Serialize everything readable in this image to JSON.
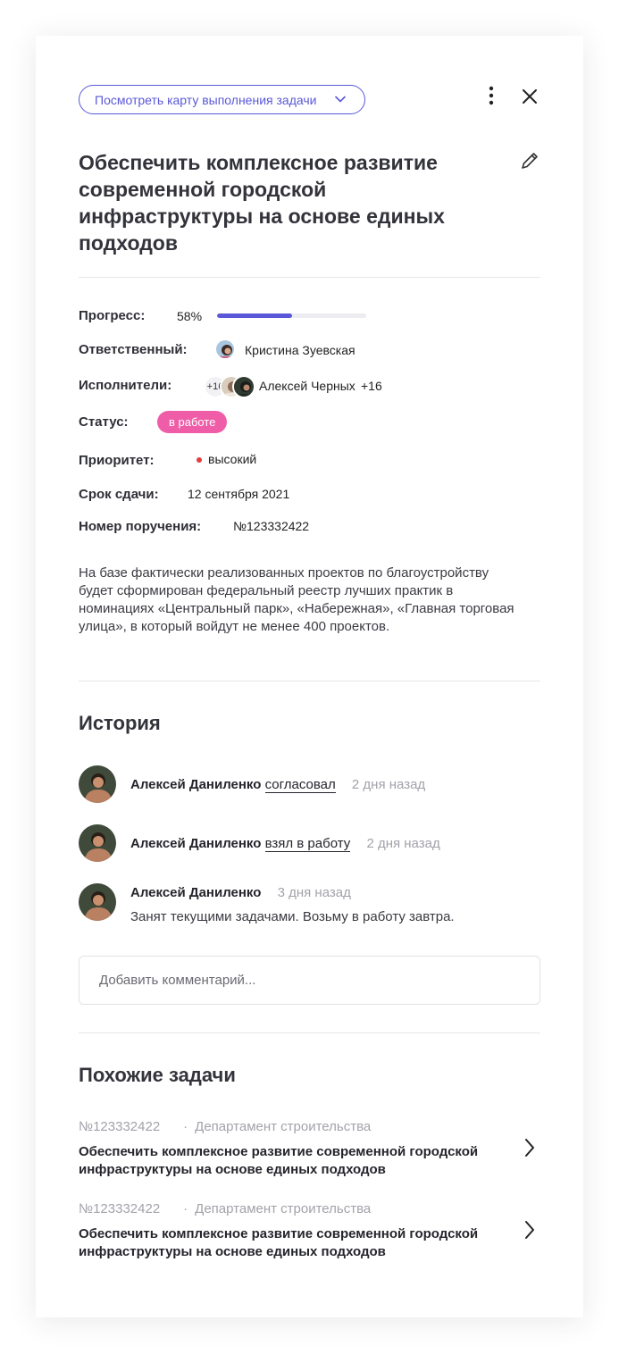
{
  "header": {
    "map_button_label": "Посмотреть карту выполнения задачи"
  },
  "task": {
    "title": "Обеспечить комплексное развитие современной городской инфраструктуры на основе единых подходов",
    "description": "На базе  фактически реализованных проектов по благоустройству будет сформирован федеральный реестр лучших практик в номинациях «Центральный парк», «Набережная», «Главная торговая улица», в который войдут не менее 400 проектов."
  },
  "properties": {
    "progress_label": "Прогресс:",
    "progress_value": "58%",
    "progress_fraction": 0.5,
    "responsible_label": "Ответственный:",
    "responsible_name": "Кристина Зуевская",
    "executors_label": "Исполнители:",
    "executors_count_badge": "+16",
    "executors_name": "Алексей Черных",
    "executors_more": "+16",
    "status_label": "Статус:",
    "status_value": "в работе",
    "priority_label": "Приоритет:",
    "priority_value": "высокий",
    "deadline_label": "Срок сдачи:",
    "deadline_value": "12 сентября 2021",
    "order_label": "Номер поручения:",
    "order_value": "№123332422"
  },
  "history": {
    "title": "История",
    "items": [
      {
        "name": "Алексей Даниленко",
        "action": "согласовал",
        "time": "2 дня назад"
      },
      {
        "name": "Алексей Даниленко",
        "action": "взял в работу",
        "time": "2 дня назад"
      },
      {
        "name": "Алексей Даниленко",
        "action": "",
        "time": "3 дня назад",
        "comment": "Занят текущими задачами. Возьму в работу завтра."
      }
    ],
    "comment_placeholder": "Добавить комментарий..."
  },
  "similar": {
    "title": "Похожие задачи",
    "items": [
      {
        "number": "№123332422",
        "dept": "Департамент строительства",
        "title": "Обеспечить комплексное развитие современной городской инфраструктуры на основе единых подходов"
      },
      {
        "number": "№123332422",
        "dept": "Департамент строительства",
        "title": "Обеспечить комплексное развитие современной городской инфраструктуры на основе единых подходов"
      }
    ],
    "separator": "·"
  },
  "colors": {
    "accent": "#5a58d8",
    "status": "#ef5da8",
    "priority_high": "#e53d3d"
  },
  "icons": {
    "map_chevron": "chevron-down-icon",
    "more": "more-vertical-icon",
    "close": "close-icon",
    "edit": "pencil-icon",
    "similar_arrow": "chevron-right-icon"
  }
}
